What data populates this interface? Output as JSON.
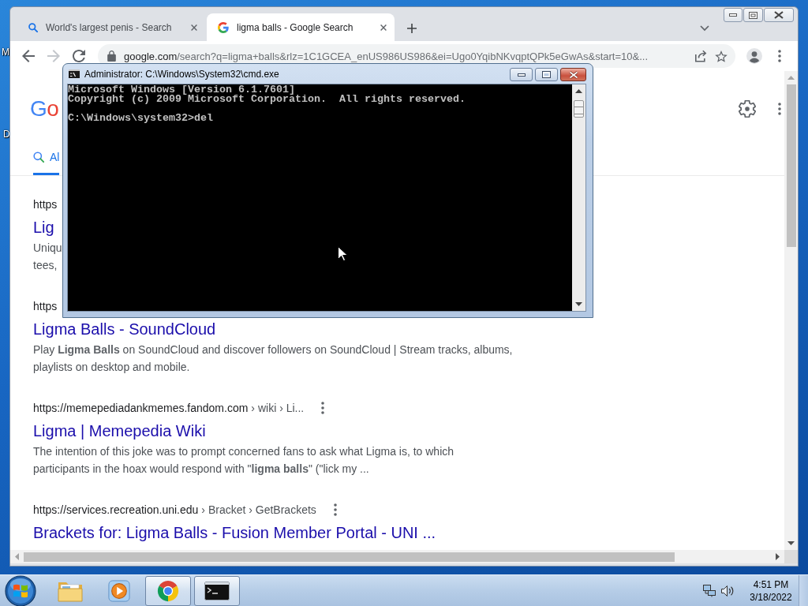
{
  "desktop": {
    "icon_labels": [
      "M",
      "D"
    ]
  },
  "browser": {
    "tabs": [
      {
        "kind": "search",
        "title": "World's largest penis - Search",
        "selected": false
      },
      {
        "kind": "google",
        "title": "ligma balls - Google Search",
        "selected": true
      }
    ],
    "nav": [
      {
        "kind": "back",
        "disabled": false
      },
      {
        "kind": "forward",
        "disabled": true
      },
      {
        "kind": "reload",
        "disabled": false
      }
    ],
    "address": {
      "host": "google.com",
      "path": "/search?q=ligma+balls&rlz=1C1GCEA_enUS986US986&ei=Ugo0YqibNKvqptQPk5eGwAs&start=10&..."
    },
    "page": {
      "logo": "Go",
      "search_tabs": [
        {
          "label": "Al",
          "selected": true
        }
      ],
      "results": [
        {
          "url": "https",
          "title": "Lig",
          "snippet": "Uniqu\ntees,",
          "menu_button": false
        },
        {
          "url": "https",
          "title": "Ligma Balls - SoundCloud",
          "snippet": "Play **Ligma Balls** on SoundCloud and discover followers on SoundCloud | Stream tracks, albums,\nplaylists on desktop and mobile.",
          "menu_button": false
        },
        {
          "url": "https://memepediadankmemes.fandom.com",
          "breadcrumb": "› wiki › Li...",
          "title": "Ligma | Memepedia Wiki",
          "snippet": "The intention of this joke was to prompt concerned fans to ask what Ligma is, to which\nparticipants in the hoax would respond with \"**ligma balls**\" (\"lick my ...",
          "menu_button": true
        },
        {
          "url": "https://services.recreation.uni.edu",
          "breadcrumb": "› Bracket › GetBrackets",
          "title": "Brackets for: Ligma Balls - Fusion Member Portal - UNI ...",
          "menu_button": true
        }
      ]
    }
  },
  "console": {
    "title": "Administrator: C:\\Windows\\System32\\cmd.exe",
    "output": "Microsoft Windows [Version 6.1.7601]\nCopyright (c) 2009 Microsoft Corporation.  All rights reserved.\n\nC:\\Windows\\system32>del"
  },
  "taskbar": {
    "apps": [
      {
        "kind": "folder",
        "running": false
      },
      {
        "kind": "media",
        "running": false
      },
      {
        "kind": "browser",
        "running": true
      },
      {
        "kind": "terminal",
        "running": true
      }
    ],
    "clock": {
      "time": "4:51 PM",
      "date": "3/18/2022"
    }
  }
}
